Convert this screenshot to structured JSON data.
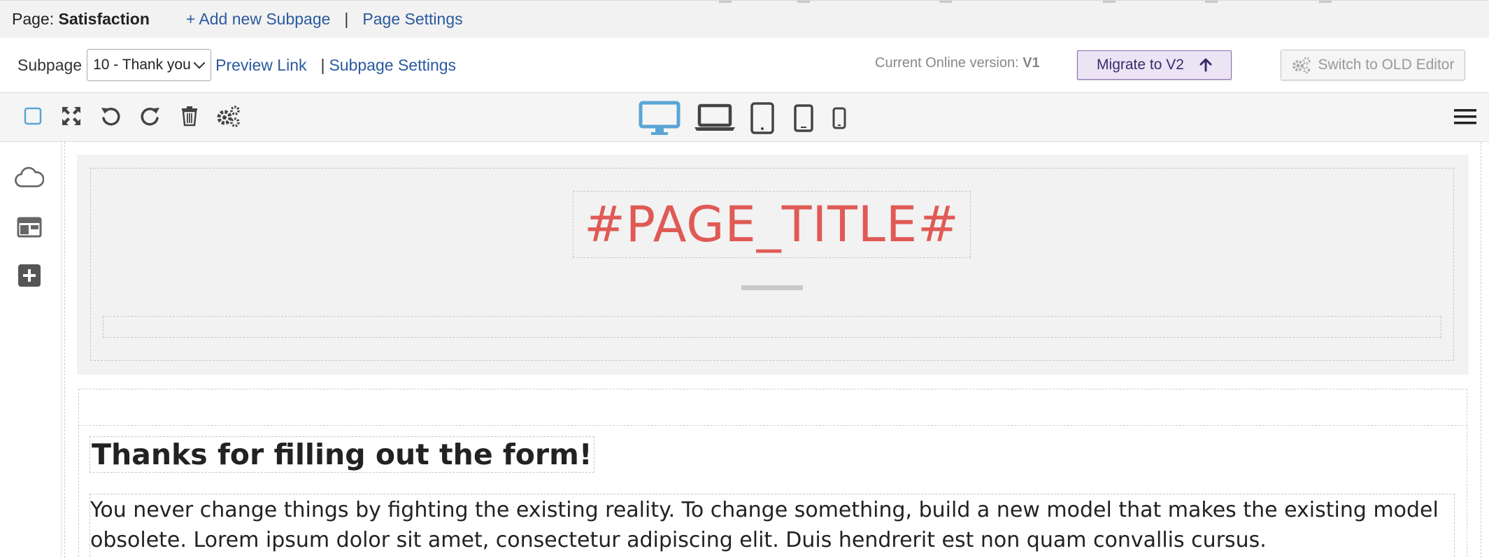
{
  "page_bar": {
    "page_prefix": "Page:",
    "page_name": "Satisfaction",
    "add_subpage": "+ Add new Subpage",
    "separator": "|",
    "page_settings": "Page Settings"
  },
  "subpage_bar": {
    "label": "Subpage",
    "selected": "10 - Thank you",
    "preview_link": "Preview Link",
    "separator": "|",
    "subpage_settings": "Subpage Settings",
    "online_version_label": "Current Online version:",
    "online_version_value": "V1",
    "migrate_label": "Migrate to V2",
    "old_editor_label": "Switch to OLD Editor"
  },
  "toolbar": {
    "tools": [
      "select-all-icon",
      "fullscreen-icon",
      "undo-icon",
      "redo-icon",
      "trash-icon",
      "settings-icon"
    ],
    "devices": [
      "desktop-icon",
      "laptop-icon",
      "tablet-icon",
      "tablet-small-icon",
      "phone-icon"
    ],
    "active_device": "desktop-icon",
    "menu_icon": "hamburger-menu-icon"
  },
  "sidebar": {
    "icons": [
      "cloud-icon",
      "layout-icon",
      "add-block-icon"
    ]
  },
  "content": {
    "page_title": "#PAGE_TITLE#",
    "heading": "Thanks for filling out the form!",
    "body": "You never change things by fighting the existing reality. To change something, build a new model that makes the existing model obsolete. Lorem ipsum dolor sit amet, consectetur adipiscing elit. Duis hendrerit est non quam convallis cursus."
  },
  "colors": {
    "accent_blue": "#5aa5d6",
    "title_red": "#e05a55",
    "migrate_purple": "#8a6cb0",
    "link_blue": "#2a5a9e"
  }
}
